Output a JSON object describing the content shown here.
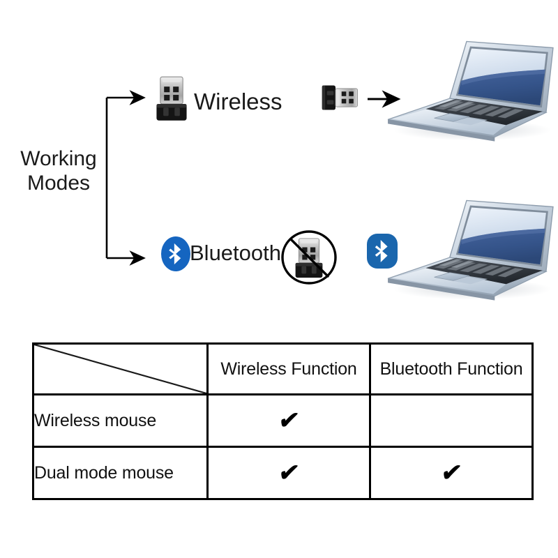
{
  "diagram": {
    "root_label": {
      "line1": "Working",
      "line2": "Modes"
    },
    "branches": [
      {
        "id": "wireless",
        "label": "Wireless",
        "icon": "usb-dongle-icon",
        "scenario": {
          "source_icon": "usb-dongle-icon",
          "arrow": "arrow-right-icon",
          "target_icon": "laptop-icon",
          "blocked": false
        }
      },
      {
        "id": "bluetooth",
        "label": "Bluetooth",
        "icon": "bluetooth-icon",
        "scenario": {
          "source_icon": "usb-dongle-prohibited-icon",
          "badge_icon": "bluetooth-icon",
          "target_icon": "laptop-icon",
          "blocked": true
        }
      }
    ]
  },
  "table": {
    "corner_cell": "",
    "column_headers": [
      "Wireless Function",
      "Bluetooth Function"
    ],
    "rows": [
      {
        "label": "Wireless mouse",
        "cells": [
          "✔",
          ""
        ]
      },
      {
        "label": "Dual mode mouse",
        "cells": [
          "✔",
          "✔"
        ]
      }
    ]
  },
  "colors": {
    "bluetooth_blue": "#1565c0",
    "bluetooth_badge_blue": "#1a66ad",
    "line_black": "#000000",
    "screen_light": "#dbe6f2",
    "screen_dark": "#35548a",
    "laptop_body": "#c3ced9",
    "dongle_metal": "#c8c8c8",
    "dongle_body": "#141414",
    "background": "#ffffff"
  }
}
